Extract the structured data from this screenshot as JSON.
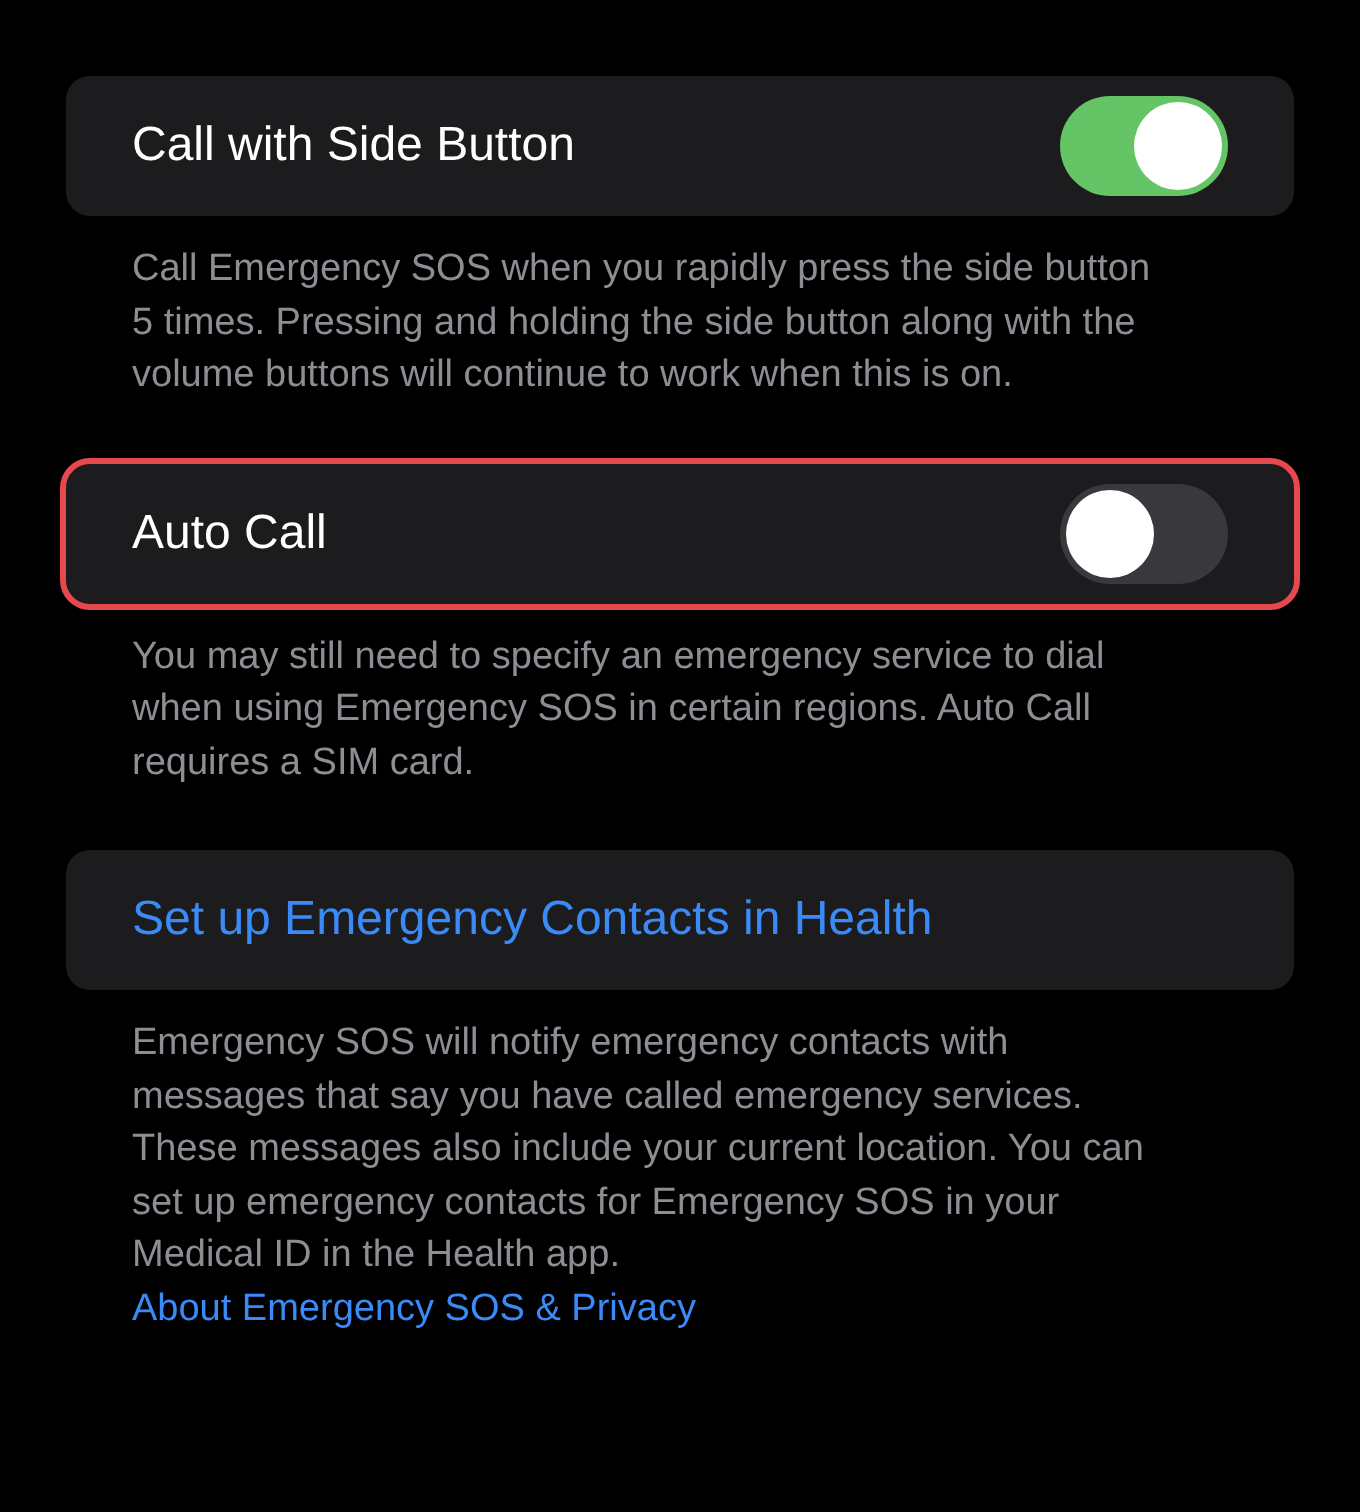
{
  "groups": [
    {
      "kind": "toggle",
      "label": "Call with Side Button",
      "on": true,
      "highlighted": false,
      "footer": "Call Emergency SOS when you rapidly press the side button 5 times. Pressing and holding the side button along with the volume buttons will continue to work when this is on."
    },
    {
      "kind": "toggle",
      "label": "Auto Call",
      "on": false,
      "highlighted": true,
      "footer": "You may still need to specify an emergency service to dial when using Emergency SOS in certain regions. Auto Call requires a SIM card."
    },
    {
      "kind": "link",
      "label": "Set up Emergency Contacts in Health",
      "highlighted": false,
      "footer": "Emergency SOS will notify emergency contacts with messages that say you have called emergency services. These messages also include your current location. You can set up emergency contacts for Emergency SOS in your Medical ID in the Health app.",
      "footer_link": "About Emergency SOS & Privacy"
    }
  ]
}
